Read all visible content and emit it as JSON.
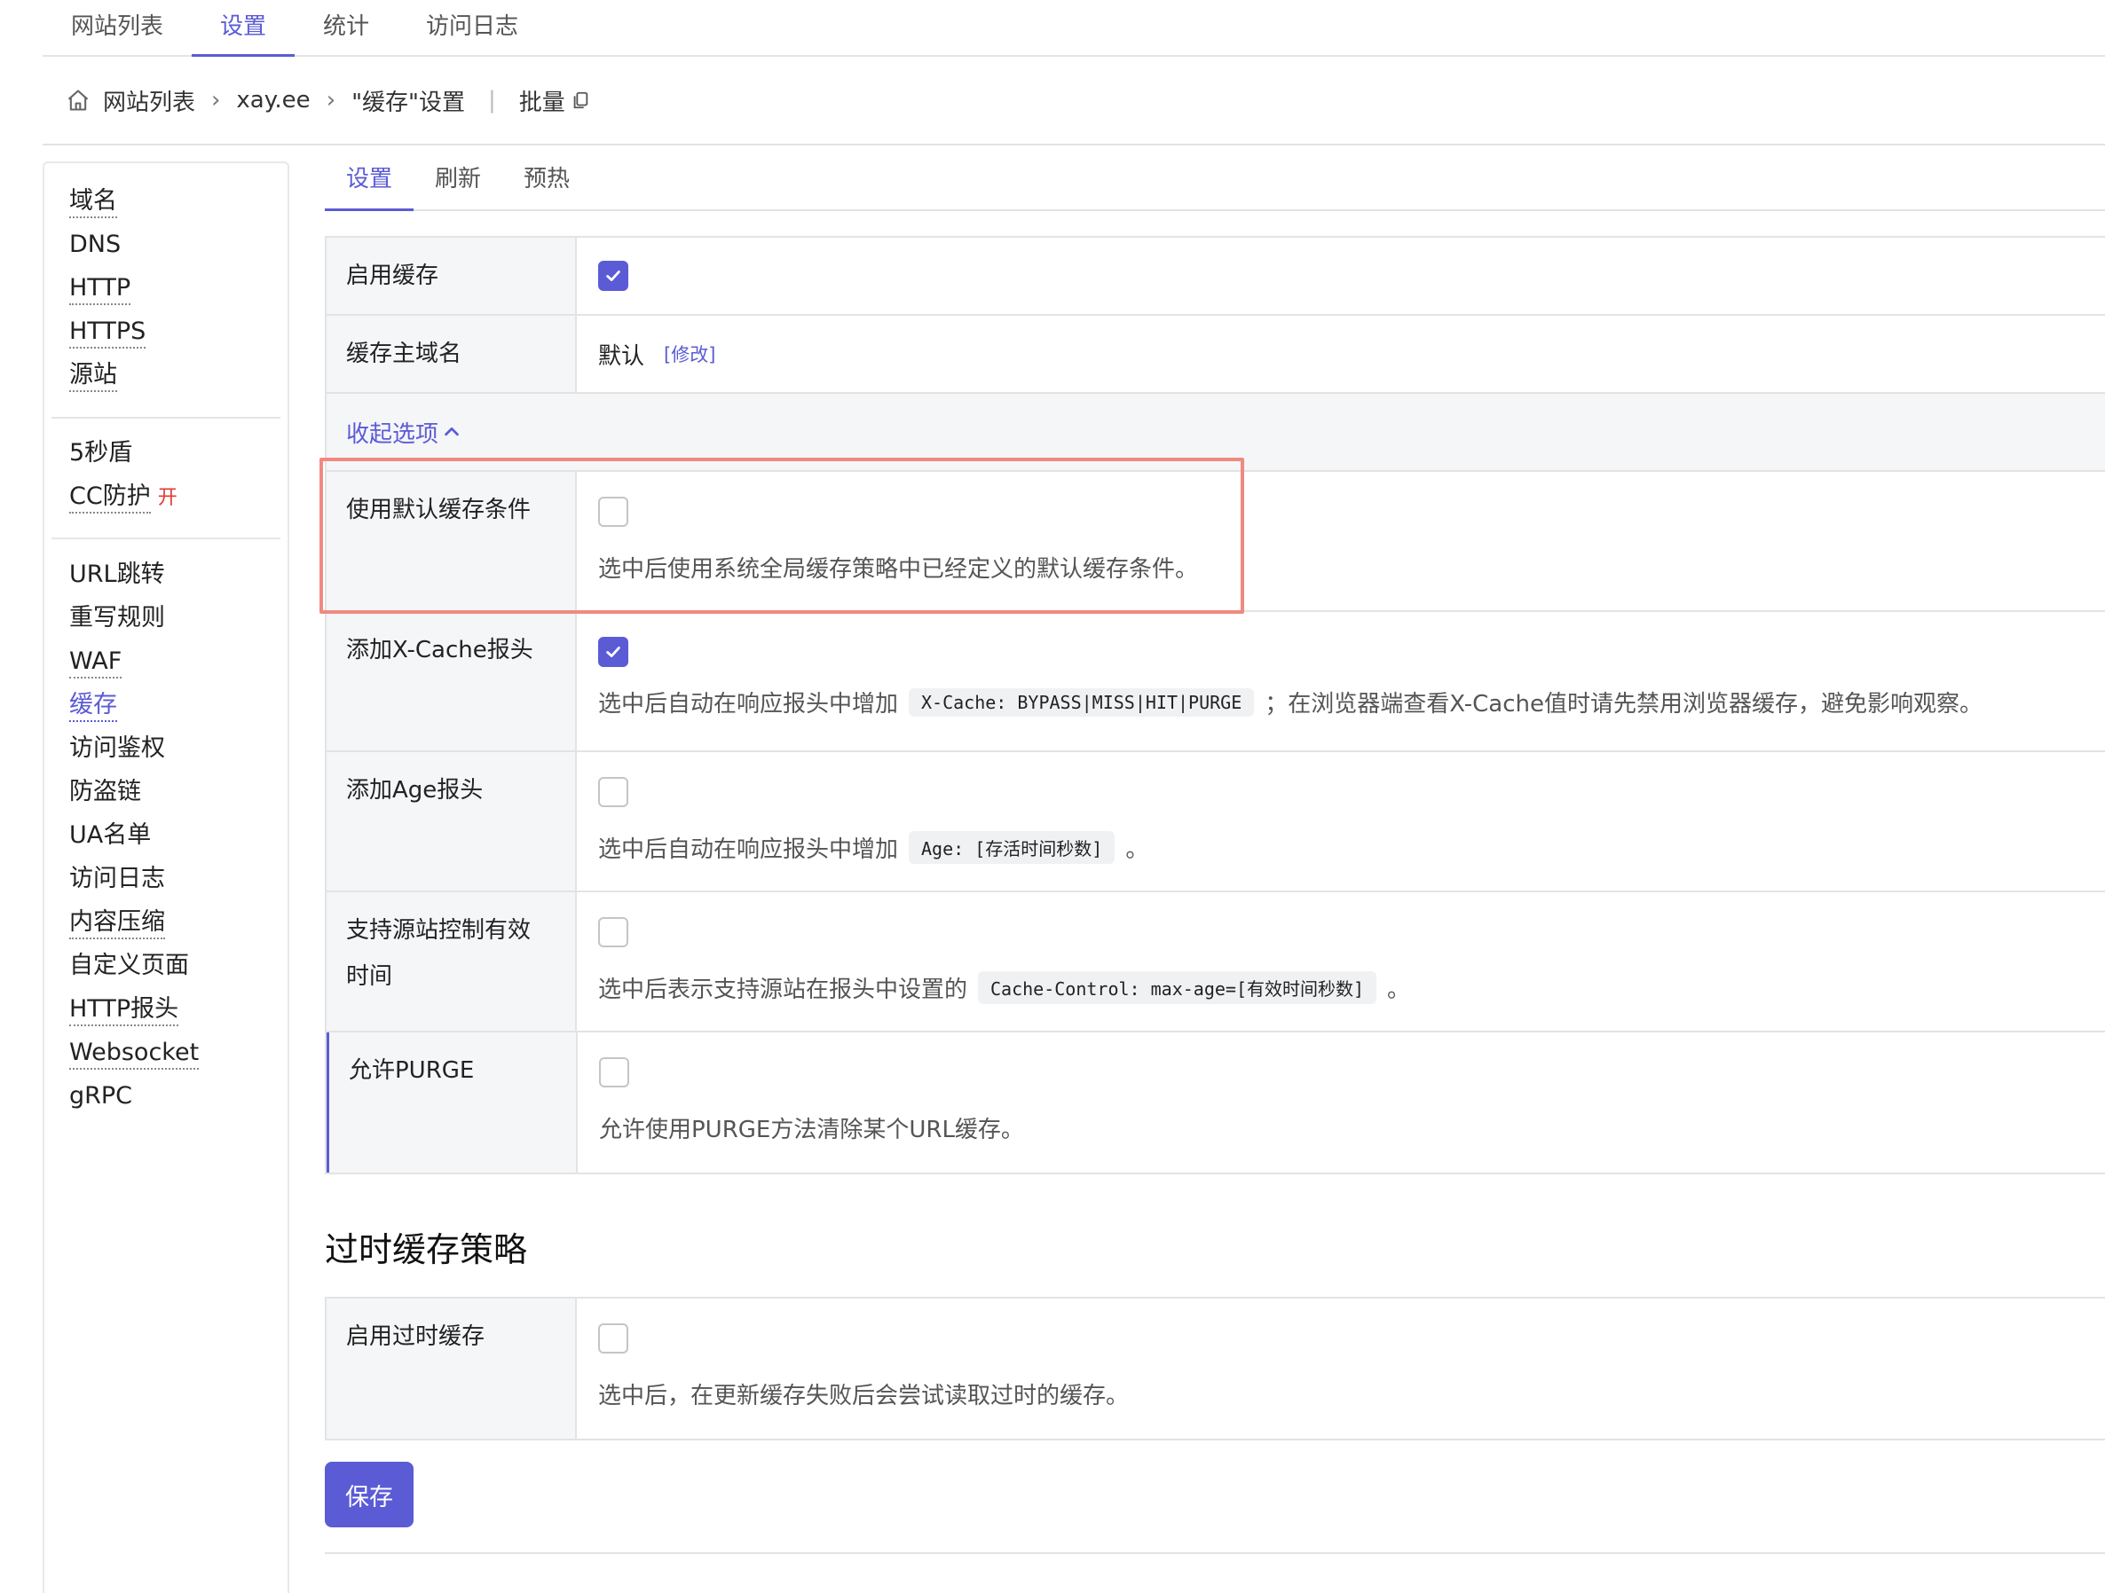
{
  "top_tabs": [
    "网站列表",
    "设置",
    "统计",
    "访问日志"
  ],
  "breadcrumb": {
    "items": [
      "网站列表",
      "xay.ee",
      "\"缓存\"设置"
    ],
    "batch_label": "批量"
  },
  "sidebar": {
    "group1": [
      "域名",
      "DNS",
      "HTTP",
      "HTTPS",
      "源站"
    ],
    "group2": [
      "5秒盾",
      "CC防护"
    ],
    "cc_badge": "开",
    "group3": [
      "URL跳转",
      "重写规则",
      "WAF",
      "缓存",
      "访问鉴权",
      "防盗链",
      "UA名单",
      "访问日志",
      "内容压缩",
      "自定义页面",
      "HTTP报头",
      "Websocket",
      "gRPC"
    ]
  },
  "inner_tabs": [
    "设置",
    "刷新",
    "预热"
  ],
  "settings": {
    "enable_cache": {
      "label": "启用缓存",
      "checked": true
    },
    "cache_host": {
      "label": "缓存主域名",
      "value": "默认",
      "modify": "[修改]"
    },
    "collapse": {
      "label": "收起选项"
    },
    "use_default": {
      "label": "使用默认缓存条件",
      "checked": false,
      "desc": "选中后使用系统全局缓存策略中已经定义的默认缓存条件。"
    },
    "x_cache": {
      "label": "添加X-Cache报头",
      "checked": true,
      "desc_before": "选中后自动在响应报头中增加",
      "code": "X-Cache: BYPASS|MISS|HIT|PURGE",
      "desc_after": "；在浏览器端查看X-Cache值时请先禁用浏览器缓存，避免影响观察。"
    },
    "age": {
      "label": "添加Age报头",
      "checked": false,
      "desc_before": "选中后自动在响应报头中增加",
      "code": "Age: [存活时间秒数]",
      "desc_after": "。"
    },
    "origin_ttl": {
      "label_line1": "支持源站控制有效",
      "label_line2": "时间",
      "checked": false,
      "desc_before": "选中后表示支持源站在报头中设置的",
      "code": "Cache-Control: max-age=[有效时间秒数]",
      "desc_after": "。"
    },
    "purge": {
      "label": "允许PURGE",
      "checked": false,
      "desc": "允许使用PURGE方法清除某个URL缓存。"
    }
  },
  "stale": {
    "title": "过时缓存策略",
    "enable": {
      "label": "启用过时缓存",
      "checked": false,
      "desc": "选中后，在更新缓存失败后会尝试读取过时的缓存。"
    }
  },
  "save_label": "保存",
  "colors": {
    "accent": "#5b5bd6",
    "highlight": "#f08a80",
    "badge": "#e53935"
  }
}
